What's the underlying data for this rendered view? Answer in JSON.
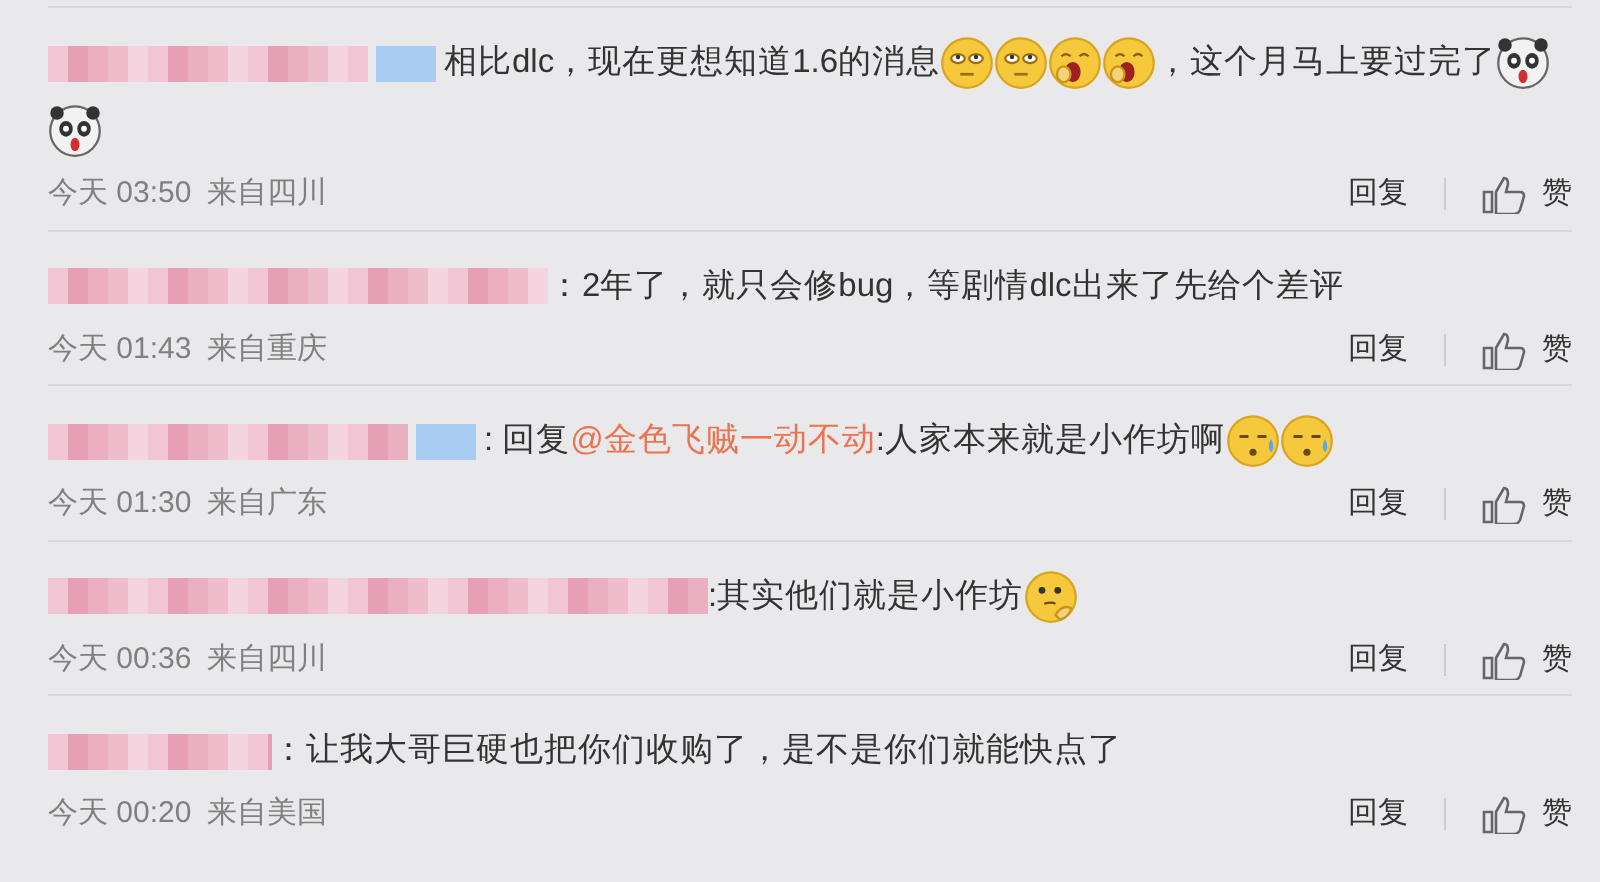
{
  "comments": [
    {
      "badge": true,
      "content": [
        {
          "kind": "text",
          "text": "相比dlc，现在更想知道1.6的消息"
        },
        {
          "kind": "face-roll"
        },
        {
          "kind": "face-roll"
        },
        {
          "kind": "face-yawn"
        },
        {
          "kind": "face-yawn"
        },
        {
          "kind": "text",
          "text": "，这个月马上要过完了"
        },
        {
          "kind": "panda"
        },
        {
          "kind": "panda"
        }
      ],
      "time": "今天 03:50",
      "source": "来自四川",
      "reply": "回复",
      "like": "赞"
    },
    {
      "badge": false,
      "content": [
        {
          "kind": "text",
          "text": "：2年了，就只会修bug，等剧情dlc出来了先给个差评"
        }
      ],
      "time": "今天 01:43",
      "source": "来自重庆",
      "reply": "回复",
      "like": "赞"
    },
    {
      "badge": true,
      "content": [
        {
          "kind": "text",
          "text": ": 回复"
        },
        {
          "kind": "mention",
          "text": "@金色飞贼一动不动"
        },
        {
          "kind": "text",
          "text": ":人家本来就是小作坊啊"
        },
        {
          "kind": "face-sweat"
        },
        {
          "kind": "face-sweat"
        }
      ],
      "time": "今天 01:30",
      "source": "来自广东",
      "reply": "回复",
      "like": "赞"
    },
    {
      "badge": false,
      "content": [
        {
          "kind": "text",
          "text": ":其实他们就是小作坊"
        },
        {
          "kind": "face-think"
        }
      ],
      "time": "今天 00:36",
      "source": "来自四川",
      "reply": "回复",
      "like": "赞"
    },
    {
      "badge": false,
      "content": [
        {
          "kind": "text",
          "text": "：让我大哥巨硬也把你们收购了，是不是你们就能快点了"
        }
      ],
      "time": "今天 00:20",
      "source": "来自美国",
      "reply": "回复",
      "like": "赞"
    }
  ]
}
